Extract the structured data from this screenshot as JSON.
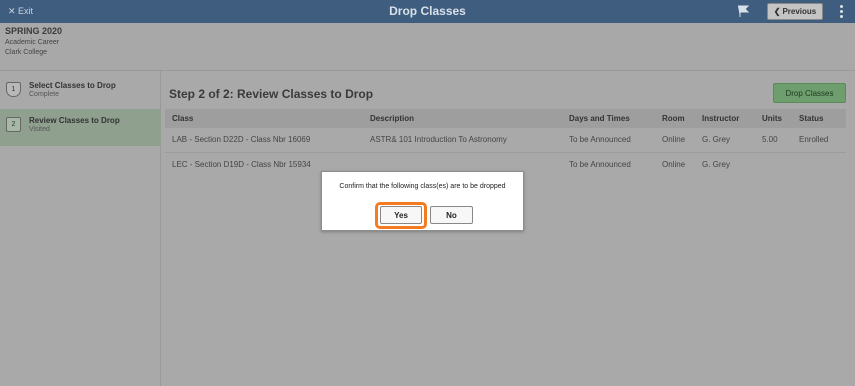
{
  "header": {
    "exit_label": "✕ Exit",
    "title": "Drop Classes",
    "flag_icon": "flag-icon",
    "previous_label": "Previous",
    "more_icon": "vertical-ellipsis-icon"
  },
  "term": {
    "name": "SPRING 2020",
    "career": "Academic Career",
    "institution": "Clark College"
  },
  "sidebar": {
    "steps": [
      {
        "number": "1",
        "label": "Select Classes to Drop",
        "status": "Complete"
      },
      {
        "number": "2",
        "label": "Review Classes to Drop",
        "status": "Visited"
      }
    ]
  },
  "main": {
    "title": "Step 2 of 2: Review Classes to Drop",
    "drop_button": "Drop Classes"
  },
  "table": {
    "columns": [
      "Class",
      "Description",
      "Days and Times",
      "Room",
      "Instructor",
      "Units",
      "Status"
    ],
    "rows": [
      {
        "class": "LAB - Section D22D - Class Nbr 16069",
        "description": "ASTR& 101  Introduction To Astronomy",
        "days_times": "To be Announced",
        "room": "Online",
        "instructor": "G. Grey",
        "units": "5.00",
        "status": "Enrolled"
      },
      {
        "class": "LEC - Section D19D - Class Nbr 15934",
        "description": "",
        "days_times": "To be Announced",
        "room": "Online",
        "instructor": "G. Grey",
        "units": "",
        "status": ""
      }
    ]
  },
  "dialog": {
    "message": "Confirm that the following class(es) are to be dropped",
    "yes_label": "Yes",
    "no_label": "No"
  },
  "colors": {
    "header_bg": "#3e5d7f",
    "overlay_gray": "#a9a9a9",
    "active_step": "#8fa08f",
    "drop_button": "#6e9d6e",
    "highlight_ring": "#f47b20"
  }
}
